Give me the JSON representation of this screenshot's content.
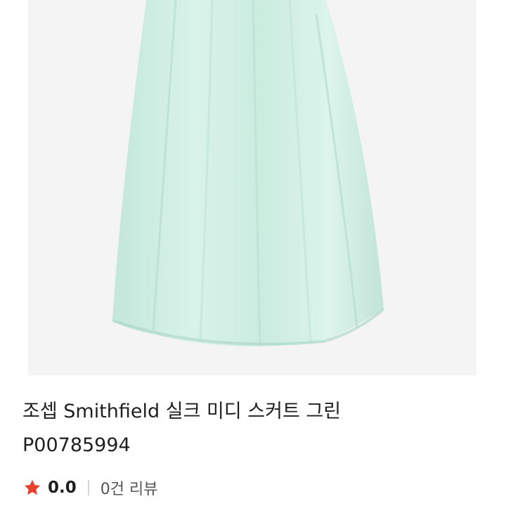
{
  "product": {
    "image_alt": "product-photo-mint-silk-skirt",
    "title": "조셉 Smithfield 실크 미디 스커트 그린",
    "code": "P00785994"
  },
  "rating": {
    "icon": "star-icon",
    "value": "0.0",
    "reviews_label": "0건 리뷰"
  },
  "colors": {
    "star": "#e8402f",
    "skirt": "#cdeee3",
    "image_bg": "#f4f4f4"
  }
}
